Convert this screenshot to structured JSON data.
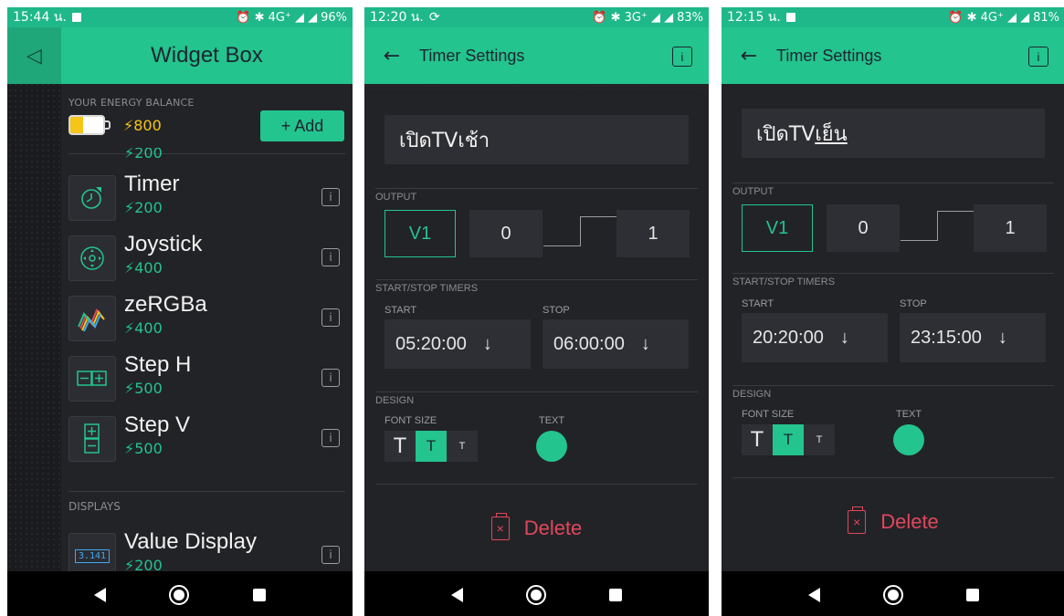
{
  "screen1": {
    "status": {
      "time": "15:44 น.",
      "indicators": "⏰ ✱ 4G⁺ ◢ ◢",
      "battery": "96%"
    },
    "title": "Widget Box",
    "energy": {
      "label": "YOUR ENERGY BALANCE",
      "value": "⚡800",
      "add_label": "+ Add"
    },
    "partial_price": "⚡200",
    "widgets": [
      {
        "name": "Timer",
        "price": "⚡200",
        "icon": "timer-icon"
      },
      {
        "name": "Joystick",
        "price": "⚡400",
        "icon": "joystick-icon"
      },
      {
        "name": "zeRGBa",
        "price": "⚡400",
        "icon": "zebra-icon"
      },
      {
        "name": "Step H",
        "price": "⚡500",
        "icon": "step-h-icon"
      },
      {
        "name": "Step V",
        "price": "⚡500",
        "icon": "step-v-icon"
      }
    ],
    "displays_label": "DISPLAYS",
    "value_display": {
      "name": "Value Display",
      "price": "⚡200",
      "icon_text": "3.141"
    },
    "info_glyph": "i"
  },
  "screen2": {
    "status": {
      "time": "12:20 น.",
      "indicators": "⏰ ✱ 3G⁺ ◢ ◢",
      "battery": "83%"
    },
    "title": "Timer Settings",
    "name_value": "เปิดTVเช้า",
    "output_label": "OUTPUT",
    "pin": "V1",
    "low": "0",
    "high": "1",
    "timers_label": "START/STOP TIMERS",
    "start_label": "START",
    "stop_label": "STOP",
    "start_time": "05:20:00",
    "stop_time": "06:00:00",
    "design_label": "DESIGN",
    "font_size_label": "FONT SIZE",
    "text_label": "TEXT",
    "font_sizes": [
      "T",
      "T",
      "T"
    ],
    "delete_label": "Delete"
  },
  "screen3": {
    "status": {
      "time": "12:15 น.",
      "indicators": "⏰ ✱ 4G⁺ ◢ ◢",
      "battery": "81%"
    },
    "title": "Timer Settings",
    "name_value_prefix": "เปิดTV",
    "name_value_suffix": "เย็น",
    "output_label": "OUTPUT",
    "pin": "V1",
    "low": "0",
    "high": "1",
    "timers_label": "START/STOP TIMERS",
    "start_label": "START",
    "stop_label": "STOP",
    "start_time": "20:20:00",
    "stop_time": "23:15:00",
    "design_label": "DESIGN",
    "font_size_label": "FONT SIZE",
    "text_label": "TEXT",
    "font_sizes": [
      "T",
      "T",
      "T"
    ],
    "delete_label": "Delete"
  },
  "colors": {
    "accent": "#23c48e",
    "background": "#222327",
    "danger": "#e0475d",
    "energy": "#f5c518"
  },
  "glyphs": {
    "back": "←",
    "down_arrow": "↓",
    "close": "◁",
    "info": "i"
  }
}
